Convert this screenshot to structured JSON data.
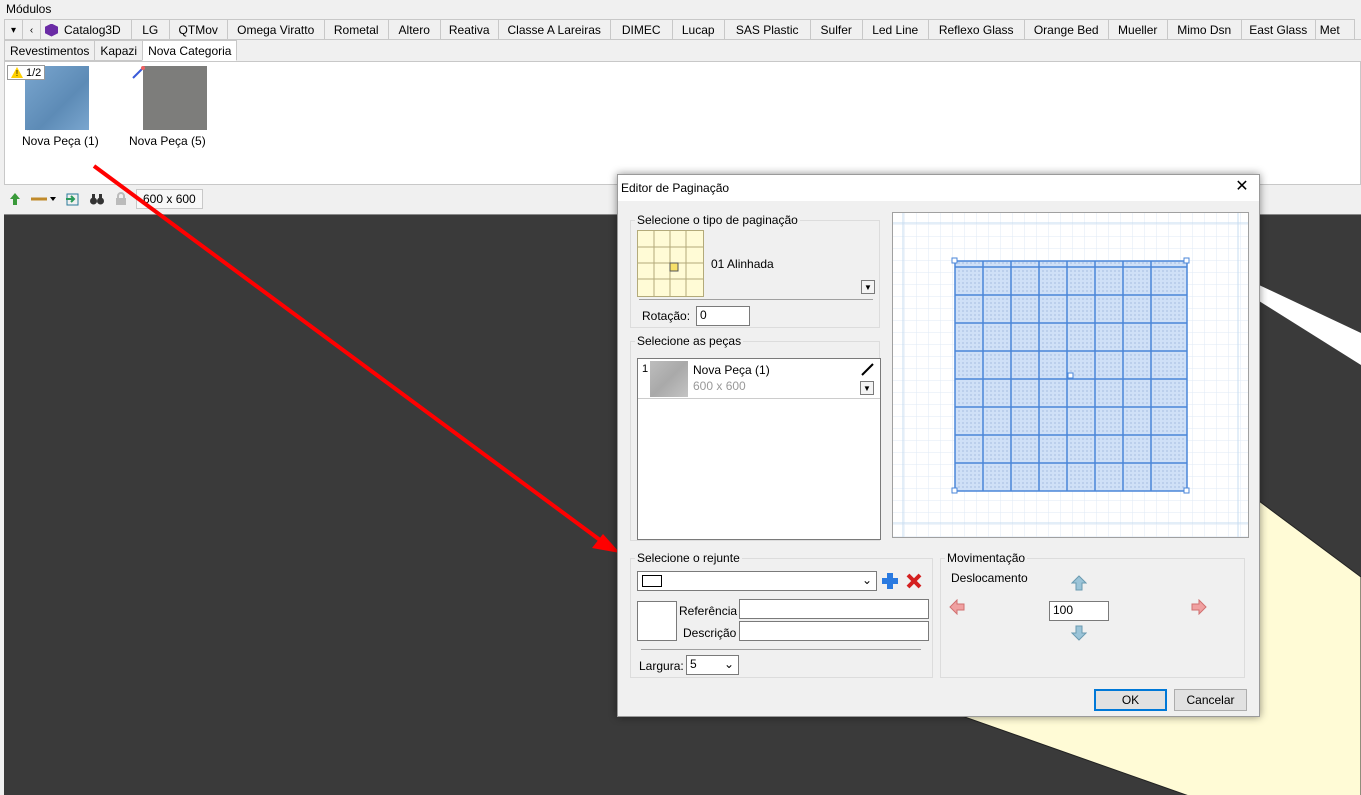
{
  "app": {
    "modules_title": "Módulos"
  },
  "top_tabs": [
    "Catalog3D",
    "LG",
    "QTMov",
    "Omega Viratto",
    "Rometal",
    "Altero",
    "Reativa",
    "Classe A Lareiras",
    "DIMEC",
    "Lucap",
    "SAS Plastic",
    "Sulfer",
    "Led Line",
    "Reflexo Glass",
    "Orange Bed",
    "Mueller",
    "Mimo Dsn",
    "East Glass",
    "Met"
  ],
  "sub_tabs": [
    "Revestimentos",
    "Kapazi",
    "Nova Categoria"
  ],
  "thumbnails": [
    {
      "label": "Nova Peça (1)",
      "badge": "1/2",
      "color": "#6f9cc6"
    },
    {
      "label": "Nova Peça (5)",
      "color": "#7d7d7b"
    }
  ],
  "toolbar": {
    "size_label": "600 x 600"
  },
  "dialog": {
    "title": "Editor de Paginação",
    "pagination_group_title": "Selecione o tipo de paginação",
    "pagination_type": "01 Alinhada",
    "rotation_label": "Rotação:",
    "rotation_value": "0",
    "pieces_group_title": "Selecione as peças",
    "piece": {
      "index": "1",
      "name": "Nova Peça (1)",
      "size": "600 x 600"
    },
    "grout_group_title": "Selecione o rejunte",
    "reference_label": "Referência",
    "description_label": "Descrição",
    "width_label": "Largura:",
    "width_value": "5",
    "movement_group_title": "Movimentação",
    "displacement_label": "Deslocamento",
    "displacement_value": "100",
    "ok_label": "OK",
    "cancel_label": "Cancelar"
  },
  "colors": {
    "accent": "#0078d7",
    "arrow": "#ff0000",
    "viewport": "#3a3a3a",
    "preview_fill": "#cfe0f7"
  }
}
